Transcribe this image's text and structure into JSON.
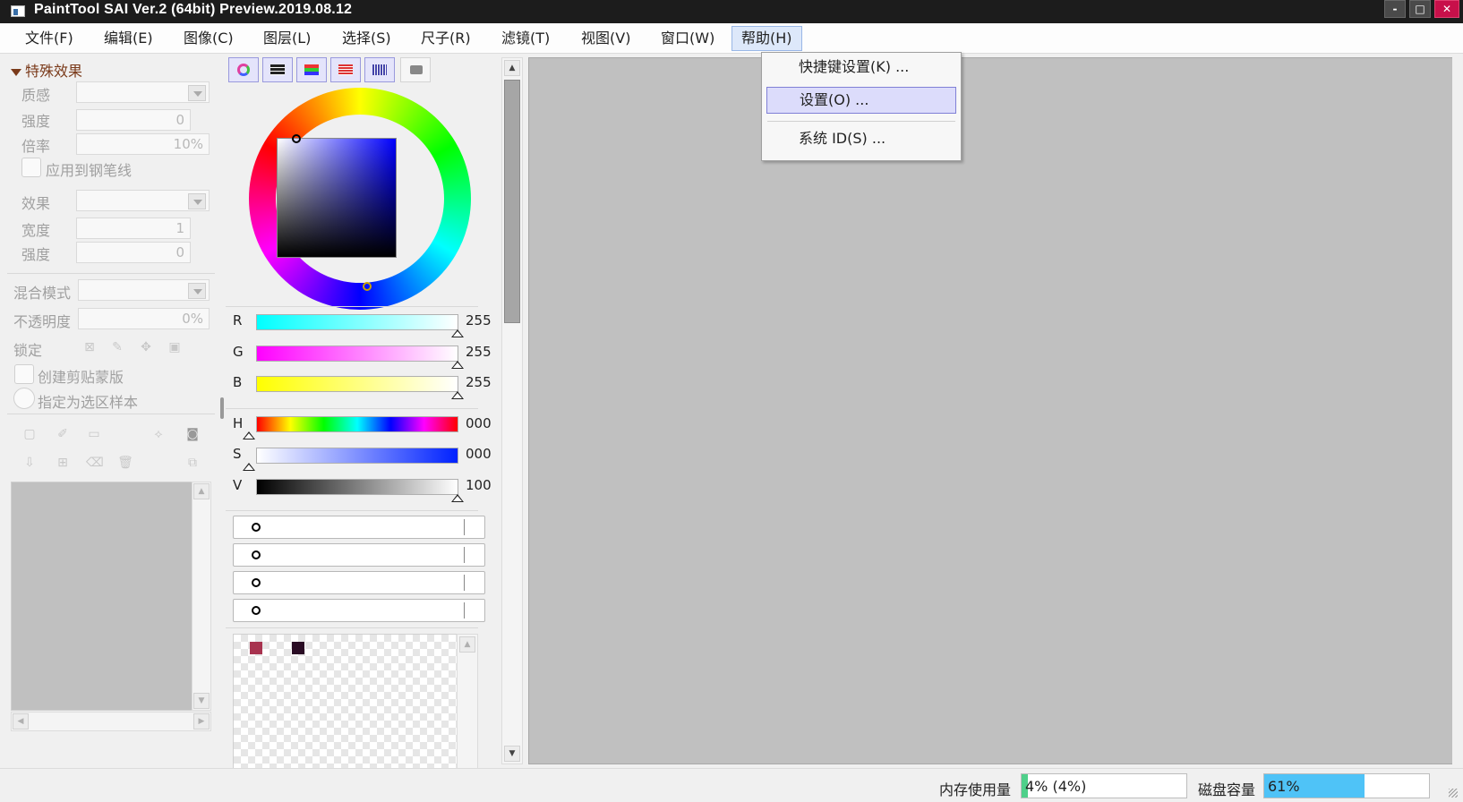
{
  "window": {
    "title": "PaintTool SAI Ver.2 (64bit) Preview.2019.08.12",
    "minimize": "-",
    "maximize": "□",
    "close": "✕"
  },
  "menubar": {
    "items": [
      "文件(F)",
      "编辑(E)",
      "图像(C)",
      "图层(L)",
      "选择(S)",
      "尺子(R)",
      "滤镜(T)",
      "视图(V)",
      "窗口(W)",
      "帮助(H)"
    ],
    "active_index": 9
  },
  "help_menu": {
    "items": [
      "快捷键设置(K) ...",
      "设置(O) ...",
      "系统 ID(S) ..."
    ],
    "highlighted_index": 1
  },
  "effects_panel": {
    "header": "特殊效果",
    "texture_label": "质感",
    "strength_label": "强度",
    "strength_value": "0",
    "scale_label": "倍率",
    "scale_value": "10%",
    "apply_to_pen_label": "应用到钢笔线",
    "effect_label": "效果",
    "width_label": "宽度",
    "width_value": "1",
    "effect_strength_label": "强度",
    "effect_strength_value": "0"
  },
  "layer_panel": {
    "blend_mode_label": "混合模式",
    "opacity_label": "不透明度",
    "opacity_value": "0%",
    "lock_label": "锁定",
    "clipping_label": "创建剪贴蒙版",
    "selection_source_label": "指定为选区样本"
  },
  "color_panel": {
    "r_label": "R",
    "r_value": "255",
    "g_label": "G",
    "g_value": "255",
    "b_label": "B",
    "b_value": "255",
    "h_label": "H",
    "h_value": "000",
    "s_label": "S",
    "s_value": "000",
    "v_label": "V",
    "v_value": "100",
    "swatches": [
      "#a8334f",
      "#2a0c24"
    ]
  },
  "status": {
    "memory_label": "内存使用量",
    "memory_value": "4% (4%)",
    "memory_percent": 4,
    "disk_label": "磁盘容量",
    "disk_value": "61%",
    "disk_percent": 61,
    "memory_color": "#4fd08a",
    "disk_color": "#4fc3f7"
  }
}
